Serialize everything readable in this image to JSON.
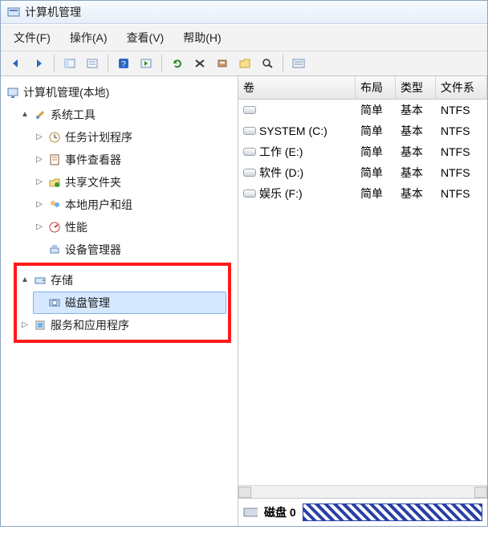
{
  "window": {
    "title": "计算机管理"
  },
  "menu": {
    "file": "文件(F)",
    "action": "操作(A)",
    "view": "查看(V)",
    "help": "帮助(H)"
  },
  "tree": {
    "root": "计算机管理(本地)",
    "systools": "系统工具",
    "task": "任务计划程序",
    "event": "事件查看器",
    "share": "共享文件夹",
    "users": "本地用户和组",
    "perf": "性能",
    "devmgr": "设备管理器",
    "storage": "存储",
    "disk": "磁盘管理",
    "services": "服务和应用程序"
  },
  "grid": {
    "headers": {
      "vol": "卷",
      "layout": "布局",
      "type": "类型",
      "fs": "文件系"
    },
    "rows": [
      {
        "name": "",
        "layout": "简单",
        "type": "基本",
        "fs": "NTFS"
      },
      {
        "name": "SYSTEM (C:)",
        "layout": "简单",
        "type": "基本",
        "fs": "NTFS"
      },
      {
        "name": "工作 (E:)",
        "layout": "简单",
        "type": "基本",
        "fs": "NTFS"
      },
      {
        "name": "软件 (D:)",
        "layout": "简单",
        "type": "基本",
        "fs": "NTFS"
      },
      {
        "name": "娱乐 (F:)",
        "layout": "简单",
        "type": "基本",
        "fs": "NTFS"
      }
    ]
  },
  "disk": {
    "label": "磁盘 0"
  }
}
